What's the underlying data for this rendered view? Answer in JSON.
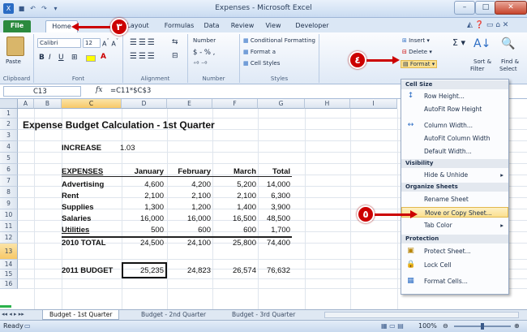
{
  "window": {
    "title": "Expenses - Microsoft Excel"
  },
  "quick_access": {
    "save_icon": "save-icon",
    "undo_icon": "undo-icon",
    "redo_icon": "redo-icon"
  },
  "tabs": [
    "File",
    "Home",
    "Layout",
    "Formulas",
    "Data",
    "Review",
    "View",
    "Developer"
  ],
  "ribbon": {
    "clipboard": {
      "paste": "Paste",
      "label": "Clipboard"
    },
    "font": {
      "name": "Calibri",
      "size": "12",
      "label": "Font"
    },
    "alignment": {
      "label": "Alignment"
    },
    "number": {
      "format": "Number",
      "currency": "$ - % ,",
      "label": "Number"
    },
    "styles": {
      "conditional": "Conditional Formatting",
      "format_as": "Format a",
      "cell_styles": "Cell Styles",
      "label": "Styles"
    },
    "cells": {
      "insert": "Insert",
      "delete": "Delete",
      "format": "Format"
    },
    "editing": {
      "sort": "Sort &",
      "filter": "Filter",
      "find": "Find &",
      "select": "Select"
    }
  },
  "formula_bar": {
    "name_box": "C13",
    "fx": "fx",
    "formula": "=C11*$C$3"
  },
  "columns": [
    "A",
    "B",
    "C",
    "D",
    "E",
    "F",
    "G",
    "H",
    "I"
  ],
  "rows": [
    "1",
    "2",
    "3",
    "4",
    "5",
    "6",
    "7",
    "8",
    "9",
    "10",
    "11",
    "12",
    "13",
    "14",
    "15",
    "16"
  ],
  "sheet": {
    "title": "Expense Budget Calculation - 1st Quarter",
    "increase_label": "INCREASE",
    "increase_value": "1.03",
    "headers": [
      "EXPENSES",
      "January",
      "February",
      "March",
      "Total"
    ],
    "lines": [
      {
        "label": "Advertising",
        "jan": "4,600",
        "feb": "4,200",
        "mar": "5,200",
        "total": "14,000"
      },
      {
        "label": "Rent",
        "jan": "2,100",
        "feb": "2,100",
        "mar": "2,100",
        "total": "6,300"
      },
      {
        "label": "Supplies",
        "jan": "1,300",
        "feb": "1,200",
        "mar": "1,400",
        "total": "3,900"
      },
      {
        "label": "Salaries",
        "jan": "16,000",
        "feb": "16,000",
        "mar": "16,500",
        "total": "48,500"
      },
      {
        "label": "Utilities",
        "jan": "500",
        "feb": "600",
        "mar": "600",
        "total": "1,700"
      }
    ],
    "total_row": {
      "label": "2010 TOTAL",
      "jan": "24,500",
      "feb": "24,100",
      "mar": "25,800",
      "total": "74,400"
    },
    "budget_row": {
      "label": "2011 BUDGET",
      "jan": "25,235",
      "feb": "24,823",
      "mar": "26,574",
      "total": "76,632"
    }
  },
  "format_menu": {
    "sections": {
      "cell_size": "Cell Size",
      "visibility": "Visibility",
      "organize": "Organize Sheets",
      "protection": "Protection"
    },
    "items": {
      "row_height": "Row Height...",
      "autofit_row": "AutoFit Row Height",
      "column_width": "Column Width...",
      "autofit_column": "AutoFit Column Width",
      "default_width": "Default Width...",
      "hide_unhide": "Hide & Unhide",
      "rename_sheet": "Rename Sheet",
      "move_copy": "Move or Copy Sheet...",
      "tab_color": "Tab Color",
      "protect_sheet": "Protect Sheet...",
      "lock_cell": "Lock Cell",
      "format_cells": "Format Cells..."
    }
  },
  "sheet_tabs": [
    "Budget - 1st Quarter",
    "Budget - 2nd Quarter",
    "Budget - 3rd Quarter"
  ],
  "status": {
    "ready": "Ready",
    "zoom": "100%"
  },
  "callouts": {
    "c3": "٣",
    "c4": "٤",
    "c5": "٥"
  },
  "colors": {
    "accent": "#c00000",
    "file_tab": "#2b8a3e",
    "highlight": "#fbe08f"
  }
}
